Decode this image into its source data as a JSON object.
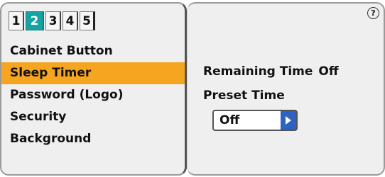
{
  "tabs": [
    "1",
    "2",
    "3",
    "4",
    "5"
  ],
  "active_tab": "2",
  "menu": [
    "Cabinet Button",
    "Sleep Timer",
    "Password (Logo)",
    "Security",
    "Background"
  ],
  "selected_menu": "Sleep Timer",
  "right": {
    "remaining_label": "Remaining Time",
    "remaining_value": "Off",
    "preset_label": "Preset Time",
    "preset_value": "Off",
    "help_glyph": "?"
  },
  "colors": {
    "active_tab": "#16a3a3",
    "selected_item": "#f5a51f",
    "arrow_button": "#2e63c2"
  }
}
